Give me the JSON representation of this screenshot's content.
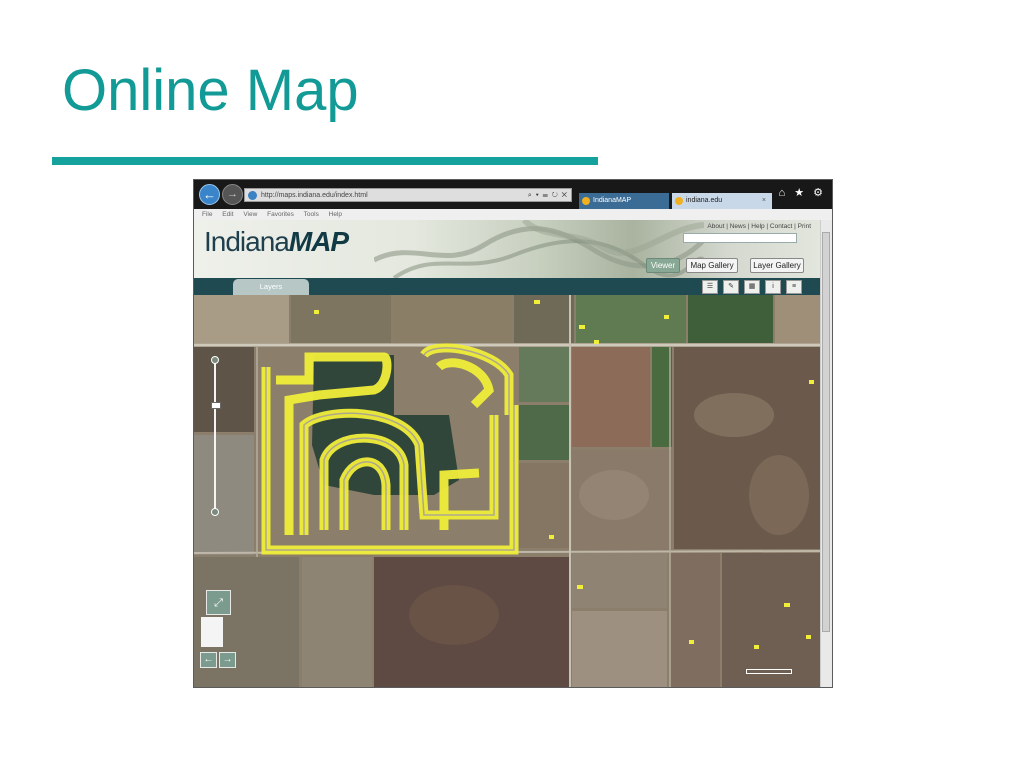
{
  "slide": {
    "title": "Online Map"
  },
  "browser": {
    "address": "http://maps.indiana.edu/index.html",
    "address_tools": "⌕ ▾ ☰ ↻ ✕",
    "tabs": [
      {
        "label": "IndianaMAP"
      },
      {
        "label": "indiana.edu",
        "close": "×"
      }
    ],
    "right_icons": "⌂ ★ ⚙",
    "menu": [
      "File",
      "Edit",
      "View",
      "Favorites",
      "Tools",
      "Help"
    ]
  },
  "site": {
    "logo_text": "Indiana",
    "logo_bold": "MAP",
    "top_links": "About | News | Help | Contact | Print",
    "buttons": {
      "viewer": "Viewer",
      "map_gallery": "Map Gallery",
      "layer_gallery": "Layer Gallery"
    },
    "layers_tab": "Layers",
    "tool_icons": [
      "list-icon",
      "draw-icon",
      "basemap-icon",
      "info-icon",
      "legend-icon"
    ],
    "colors": {
      "title": "#119a96",
      "strip": "#1f4a52",
      "parcel_highlight": "#f1ee3a"
    }
  },
  "map": {
    "controls": {
      "full_extent": "⤢",
      "prev": "←",
      "next": "→"
    }
  }
}
